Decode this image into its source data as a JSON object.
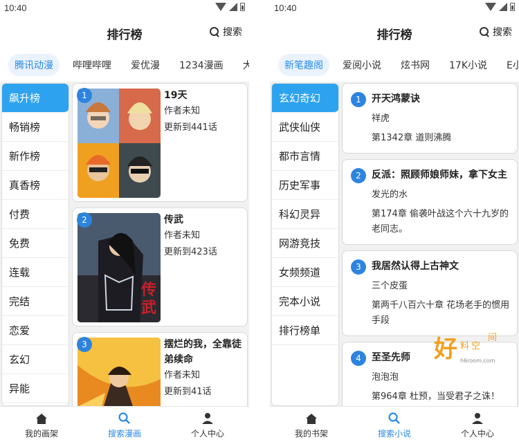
{
  "left": {
    "status_time": "10:40",
    "title": "排行榜",
    "search_label": "搜索",
    "tabs": [
      {
        "label": "腾讯动漫",
        "active": true
      },
      {
        "label": "哔哩哔哩",
        "active": false
      },
      {
        "label": "爱优漫",
        "active": false
      },
      {
        "label": "1234漫画",
        "active": false
      },
      {
        "label": "大树",
        "active": false
      }
    ],
    "sidebar": [
      {
        "label": "飙升榜",
        "active": true
      },
      {
        "label": "畅销榜",
        "active": false
      },
      {
        "label": "新作榜",
        "active": false
      },
      {
        "label": "真香榜",
        "active": false
      },
      {
        "label": "付费",
        "active": false
      },
      {
        "label": "免费",
        "active": false
      },
      {
        "label": "连载",
        "active": false
      },
      {
        "label": "完结",
        "active": false
      },
      {
        "label": "恋爱",
        "active": false
      },
      {
        "label": "玄幻",
        "active": false
      },
      {
        "label": "异能",
        "active": false
      }
    ],
    "items": [
      {
        "rank": "1",
        "title": "19天",
        "author": "作者未知",
        "update": "更新到441话"
      },
      {
        "rank": "2",
        "title": "传武",
        "author": "作者未知",
        "update": "更新到423话"
      },
      {
        "rank": "3",
        "title": "摆烂的我，全靠徒弟续命",
        "author": "作者未知",
        "update": "更新到41话"
      }
    ],
    "nav": [
      {
        "label": "我的画架",
        "icon": "bookshelf-icon",
        "active": false
      },
      {
        "label": "搜索漫画",
        "icon": "search-icon",
        "active": true
      },
      {
        "label": "个人中心",
        "icon": "person-icon",
        "active": false
      }
    ]
  },
  "right": {
    "status_time": "10:40",
    "title": "排行榜",
    "search_label": "搜索",
    "tabs": [
      {
        "label": "新笔趣阁",
        "active": true
      },
      {
        "label": "爱阅小说",
        "active": false
      },
      {
        "label": "炫书网",
        "active": false
      },
      {
        "label": "17K小说",
        "active": false
      },
      {
        "label": "E小说",
        "active": false
      }
    ],
    "sidebar": [
      {
        "label": "玄幻奇幻",
        "active": true
      },
      {
        "label": "武侠仙侠",
        "active": false
      },
      {
        "label": "都市言情",
        "active": false
      },
      {
        "label": "历史军事",
        "active": false
      },
      {
        "label": "科幻灵异",
        "active": false
      },
      {
        "label": "网游竞技",
        "active": false
      },
      {
        "label": "女频频道",
        "active": false
      },
      {
        "label": "完本小说",
        "active": false
      },
      {
        "label": "排行榜单",
        "active": false
      }
    ],
    "items": [
      {
        "rank": "1",
        "title": "开天鸿蒙诀",
        "author": "祥虎",
        "chapter": "第1342章 道则沸腾"
      },
      {
        "rank": "2",
        "title": "反派：照顾师娘师妹，拿下女主我无敌了",
        "author": "发光的水",
        "chapter": "第174章 偷袭叶战这个六十九岁的老同志。"
      },
      {
        "rank": "3",
        "title": "我居然认得上古神文",
        "author": "三个皮蛋",
        "chapter": "第两千八百六十章 花场老手的惯用手段"
      },
      {
        "rank": "4",
        "title": "至圣先师",
        "author": "泡泡泡",
        "chapter": "第964章 杜预，当受君子之诛！"
      }
    ],
    "nav": [
      {
        "label": "我的书架",
        "icon": "bookshelf-icon",
        "active": false
      },
      {
        "label": "搜索小说",
        "icon": "search-icon",
        "active": true
      },
      {
        "label": "个人中心",
        "icon": "person-icon",
        "active": false
      }
    ]
  },
  "watermark": {
    "logo_text": "好料空间",
    "site": "h6room.com"
  },
  "colors": {
    "accent": "#2b8ae6",
    "active_side": "#2da3ef",
    "badge": "#2d84e0",
    "tab_bg": "#eaf3fd"
  }
}
